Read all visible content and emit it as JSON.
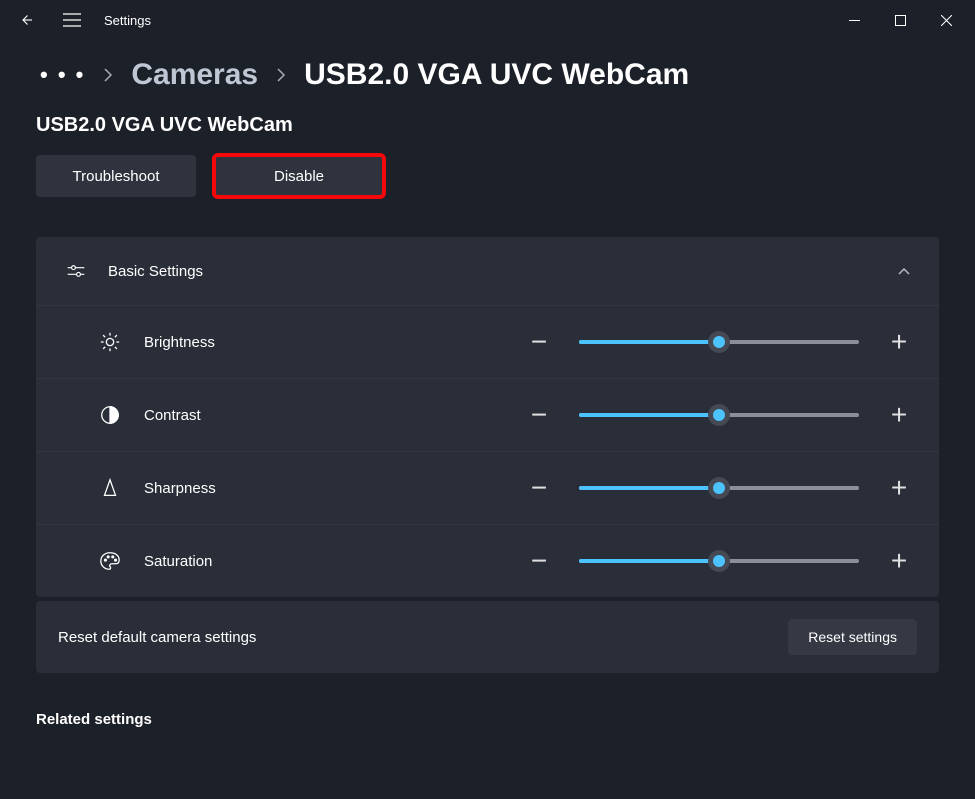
{
  "app_title": "Settings",
  "breadcrumb": {
    "ellipsis": "• • •",
    "parent": "Cameras",
    "current": "USB2.0 VGA UVC WebCam"
  },
  "subtitle": "USB2.0 VGA UVC WebCam",
  "actions": {
    "troubleshoot": "Troubleshoot",
    "disable": "Disable"
  },
  "basic_settings": {
    "title": "Basic Settings",
    "rows": [
      {
        "label": "Brightness",
        "value": 50
      },
      {
        "label": "Contrast",
        "value": 50
      },
      {
        "label": "Sharpness",
        "value": 50
      },
      {
        "label": "Saturation",
        "value": 50
      }
    ]
  },
  "reset": {
    "label": "Reset default camera settings",
    "button": "Reset settings"
  },
  "related_settings": "Related settings",
  "colors": {
    "accent": "#4cc2ff",
    "highlight": "#f5070a"
  }
}
